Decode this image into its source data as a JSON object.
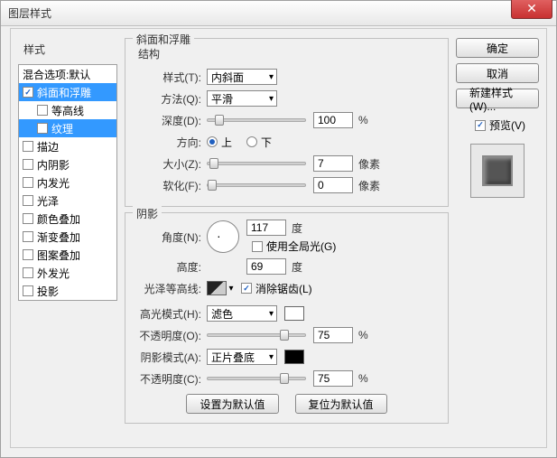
{
  "window": {
    "title": "图层样式"
  },
  "left": {
    "header": "样式",
    "items": [
      {
        "label": "混合选项:默认",
        "checked": false,
        "selected": false,
        "indent": false,
        "nocb": true
      },
      {
        "label": "斜面和浮雕",
        "checked": true,
        "selected": true,
        "indent": false
      },
      {
        "label": "等高线",
        "checked": false,
        "selected": false,
        "indent": true
      },
      {
        "label": "纹理",
        "checked": false,
        "selected": true,
        "indent": true
      },
      {
        "label": "描边",
        "checked": false,
        "selected": false,
        "indent": false
      },
      {
        "label": "内阴影",
        "checked": false,
        "selected": false,
        "indent": false
      },
      {
        "label": "内发光",
        "checked": false,
        "selected": false,
        "indent": false
      },
      {
        "label": "光泽",
        "checked": false,
        "selected": false,
        "indent": false
      },
      {
        "label": "颜色叠加",
        "checked": false,
        "selected": false,
        "indent": false
      },
      {
        "label": "渐变叠加",
        "checked": false,
        "selected": false,
        "indent": false
      },
      {
        "label": "图案叠加",
        "checked": false,
        "selected": false,
        "indent": false
      },
      {
        "label": "外发光",
        "checked": false,
        "selected": false,
        "indent": false
      },
      {
        "label": "投影",
        "checked": false,
        "selected": false,
        "indent": false
      }
    ]
  },
  "bevel": {
    "title": "斜面和浮雕",
    "structure_title": "结构",
    "style_label": "样式(T):",
    "style_value": "内斜面",
    "technique_label": "方法(Q):",
    "technique_value": "平滑",
    "depth_label": "深度(D):",
    "depth_value": "100",
    "depth_unit": "%",
    "direction_label": "方向:",
    "up": "上",
    "down": "下",
    "size_label": "大小(Z):",
    "size_value": "7",
    "size_unit": "像素",
    "soften_label": "软化(F):",
    "soften_value": "0",
    "soften_unit": "像素",
    "shading_title": "阴影",
    "angle_label": "角度(N):",
    "angle_value": "117",
    "angle_unit": "度",
    "global_label": "使用全局光(G)",
    "altitude_label": "高度:",
    "altitude_value": "69",
    "altitude_unit": "度",
    "gloss_label": "光泽等高线:",
    "antialias_label": "消除锯齿(L)",
    "highlight_mode_label": "高光模式(H):",
    "highlight_mode_value": "滤色",
    "highlight_opacity_label": "不透明度(O):",
    "highlight_opacity_value": "75",
    "pct": "%",
    "shadow_mode_label": "阴影模式(A):",
    "shadow_mode_value": "正片叠底",
    "shadow_opacity_label": "不透明度(C):",
    "shadow_opacity_value": "75",
    "make_default": "设置为默认值",
    "reset_default": "复位为默认值"
  },
  "right": {
    "ok": "确定",
    "cancel": "取消",
    "new_style": "新建样式(W)...",
    "preview": "预览(V)"
  }
}
